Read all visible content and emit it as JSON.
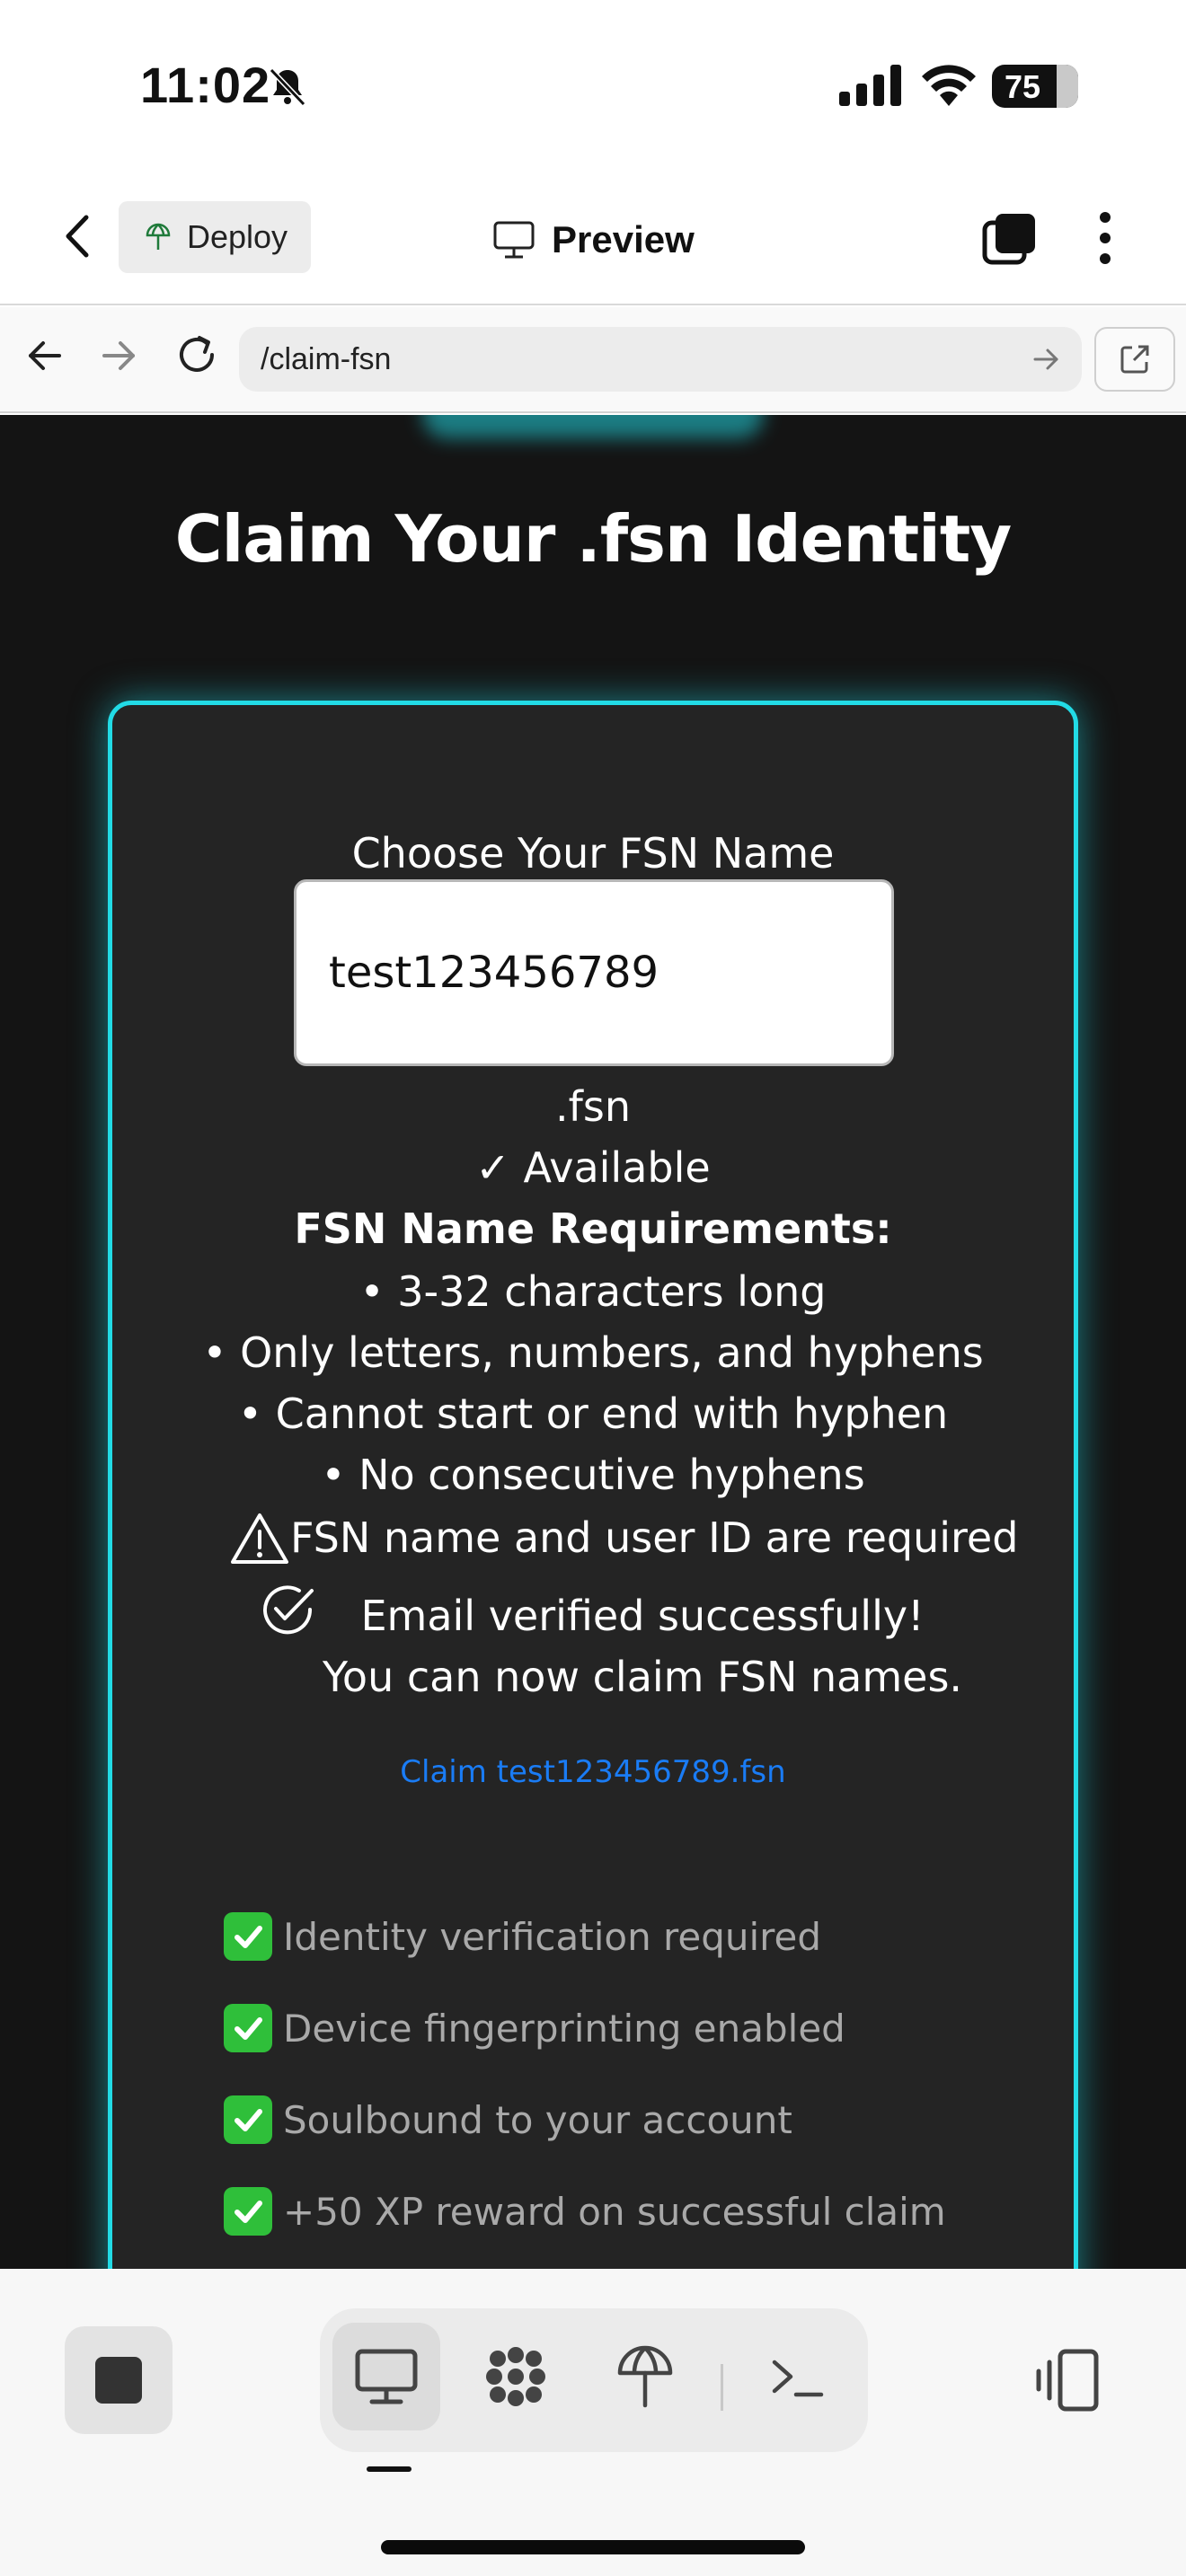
{
  "status_bar": {
    "time": "11:02",
    "battery": "75"
  },
  "header": {
    "deploy_label": "Deploy",
    "preview_label": "Preview"
  },
  "url_bar": {
    "url": "/claim-fsn"
  },
  "page": {
    "title": "Claim Your .fsn Identity",
    "form": {
      "label": "Choose Your FSN Name",
      "input_value": "test123456789",
      "suffix": ".fsn",
      "availability": "✓ Available",
      "requirements_title": "FSN Name Requirements:",
      "requirements": [
        "• 3-32 characters long",
        "• Only letters, numbers, and hyphens",
        "• Cannot start or end with hyphen",
        "• No consecutive hyphens"
      ],
      "error_message": "FSN name and user ID are required",
      "success_message": "Email verified successfully! You can now claim FSN names.",
      "claim_link": "Claim test123456789.fsn"
    },
    "features": [
      "Identity verification required",
      "Device fingerprinting enabled",
      "Soulbound to your account",
      "+50 XP reward on successful claim"
    ]
  },
  "colors": {
    "accent": "#22dbe6",
    "link": "#1a7cf5",
    "check": "#2fbf3a",
    "page_bg": "#141414",
    "card_bg": "#242424"
  }
}
